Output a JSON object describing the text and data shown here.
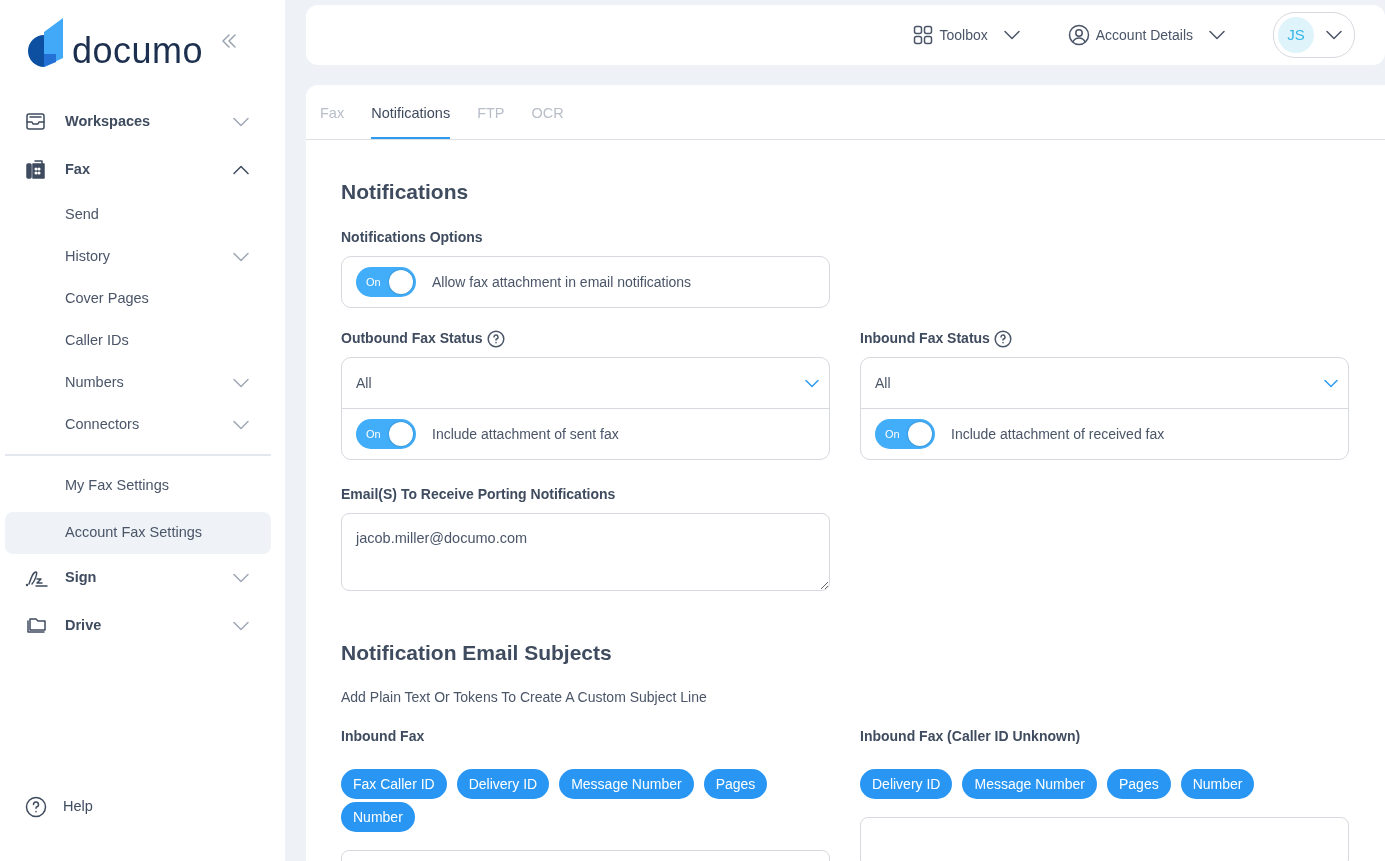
{
  "logo": {
    "text": "documo"
  },
  "sidebar": {
    "items": [
      {
        "label": "Workspaces",
        "expanded": false
      },
      {
        "label": "Fax",
        "expanded": true,
        "children": [
          {
            "label": "Send",
            "has_submenu": false,
            "divider_before": false,
            "selected": false
          },
          {
            "label": "History",
            "has_submenu": true,
            "divider_before": false,
            "selected": false
          },
          {
            "label": "Cover Pages",
            "has_submenu": false,
            "divider_before": false,
            "selected": false
          },
          {
            "label": "Caller IDs",
            "has_submenu": false,
            "divider_before": false,
            "selected": false
          },
          {
            "label": "Numbers",
            "has_submenu": true,
            "divider_before": false,
            "selected": false
          },
          {
            "label": "Connectors",
            "has_submenu": true,
            "divider_before": false,
            "selected": false
          },
          {
            "label": "My Fax Settings",
            "has_submenu": false,
            "divider_before": true,
            "selected": false
          },
          {
            "label": "Account Fax Settings",
            "has_submenu": false,
            "divider_before": false,
            "selected": true
          }
        ]
      },
      {
        "label": "Sign",
        "expanded": false
      },
      {
        "label": "Drive",
        "expanded": false
      }
    ],
    "help": "Help"
  },
  "header": {
    "toolbox": "Toolbox",
    "account": "Account Details",
    "avatar_initials": "JS"
  },
  "tabs": [
    {
      "label": "Fax",
      "selected": false
    },
    {
      "label": "Notifications",
      "selected": true
    },
    {
      "label": "FTP",
      "selected": false
    },
    {
      "label": "OCR",
      "selected": false
    }
  ],
  "title": "Notifications",
  "options": {
    "label": "Notifications Options",
    "toggle": {
      "on": true,
      "text": "On",
      "label": "Allow fax attachment in email notifications"
    }
  },
  "status_groups": [
    {
      "label": "Outbound Fax Status",
      "value": "All",
      "toggle": {
        "on": true,
        "text": "On",
        "label": "Include attachment of sent fax"
      }
    },
    {
      "label": "Inbound Fax Status",
      "value": "All",
      "toggle": {
        "on": true,
        "text": "On",
        "label": "Include attachment of received fax"
      }
    }
  ],
  "porting": {
    "label": "Email(S) To Receive Porting Notifications",
    "value": "jacob.miller@documo.com"
  },
  "subjects": {
    "title": "Notification Email Subjects",
    "hint": "Add Plain Text Or Tokens To Create A Custom Subject Line",
    "groups": [
      {
        "label": "Inbound Fax",
        "tokens": [
          "Fax Caller ID",
          "Delivery ID",
          "Message Number",
          "Pages",
          "Number"
        ]
      },
      {
        "label": "Inbound Fax (Caller ID Unknown)",
        "tokens": [
          "Delivery ID",
          "Message Number",
          "Pages",
          "Number"
        ]
      }
    ]
  }
}
